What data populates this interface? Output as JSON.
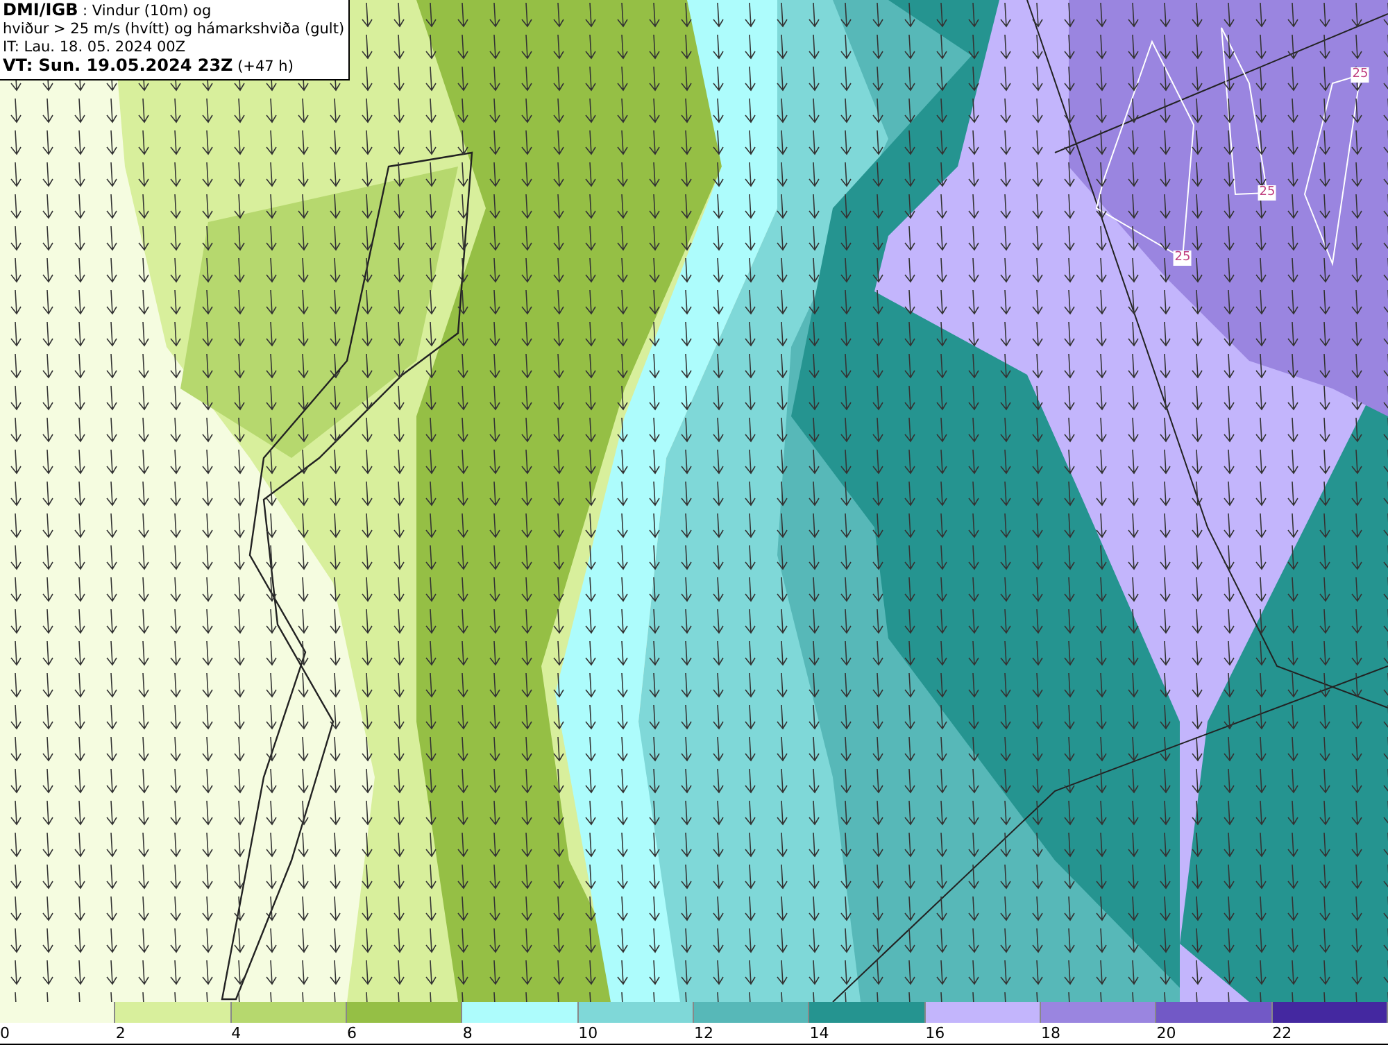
{
  "header": {
    "lines": [
      "**DMI/IGB** : Vindur (10m) og",
      "hviður > 25 m/s (hvítt) og hámarkshviða (gult)",
      "IT: Lau. 18. 05. 2024 00Z",
      "**VT: Sun. 19.05.2024 23Z** (+47 h)"
    ]
  },
  "contour_labels": [
    {
      "text": "25"
    },
    {
      "text": "25"
    },
    {
      "text": "25"
    }
  ],
  "legend": [
    {
      "color": "#f5fce0",
      "label": "0"
    },
    {
      "color": "#d8ef9c",
      "label": "2"
    },
    {
      "color": "#b6d86e",
      "label": "4"
    },
    {
      "color": "#95bf45",
      "label": "6"
    },
    {
      "color": "#adfcfc",
      "label": "8"
    },
    {
      "color": "#7fd8d8",
      "label": "10"
    },
    {
      "color": "#57b8b8",
      "label": "12"
    },
    {
      "color": "#259490",
      "label": "14"
    },
    {
      "color": "#c3b5fc",
      "label": "16"
    },
    {
      "color": "#9a85e0",
      "label": "18"
    },
    {
      "color": "#7259c6",
      "label": "20"
    },
    {
      "color": "#4428a0",
      "label": "22"
    }
  ]
}
